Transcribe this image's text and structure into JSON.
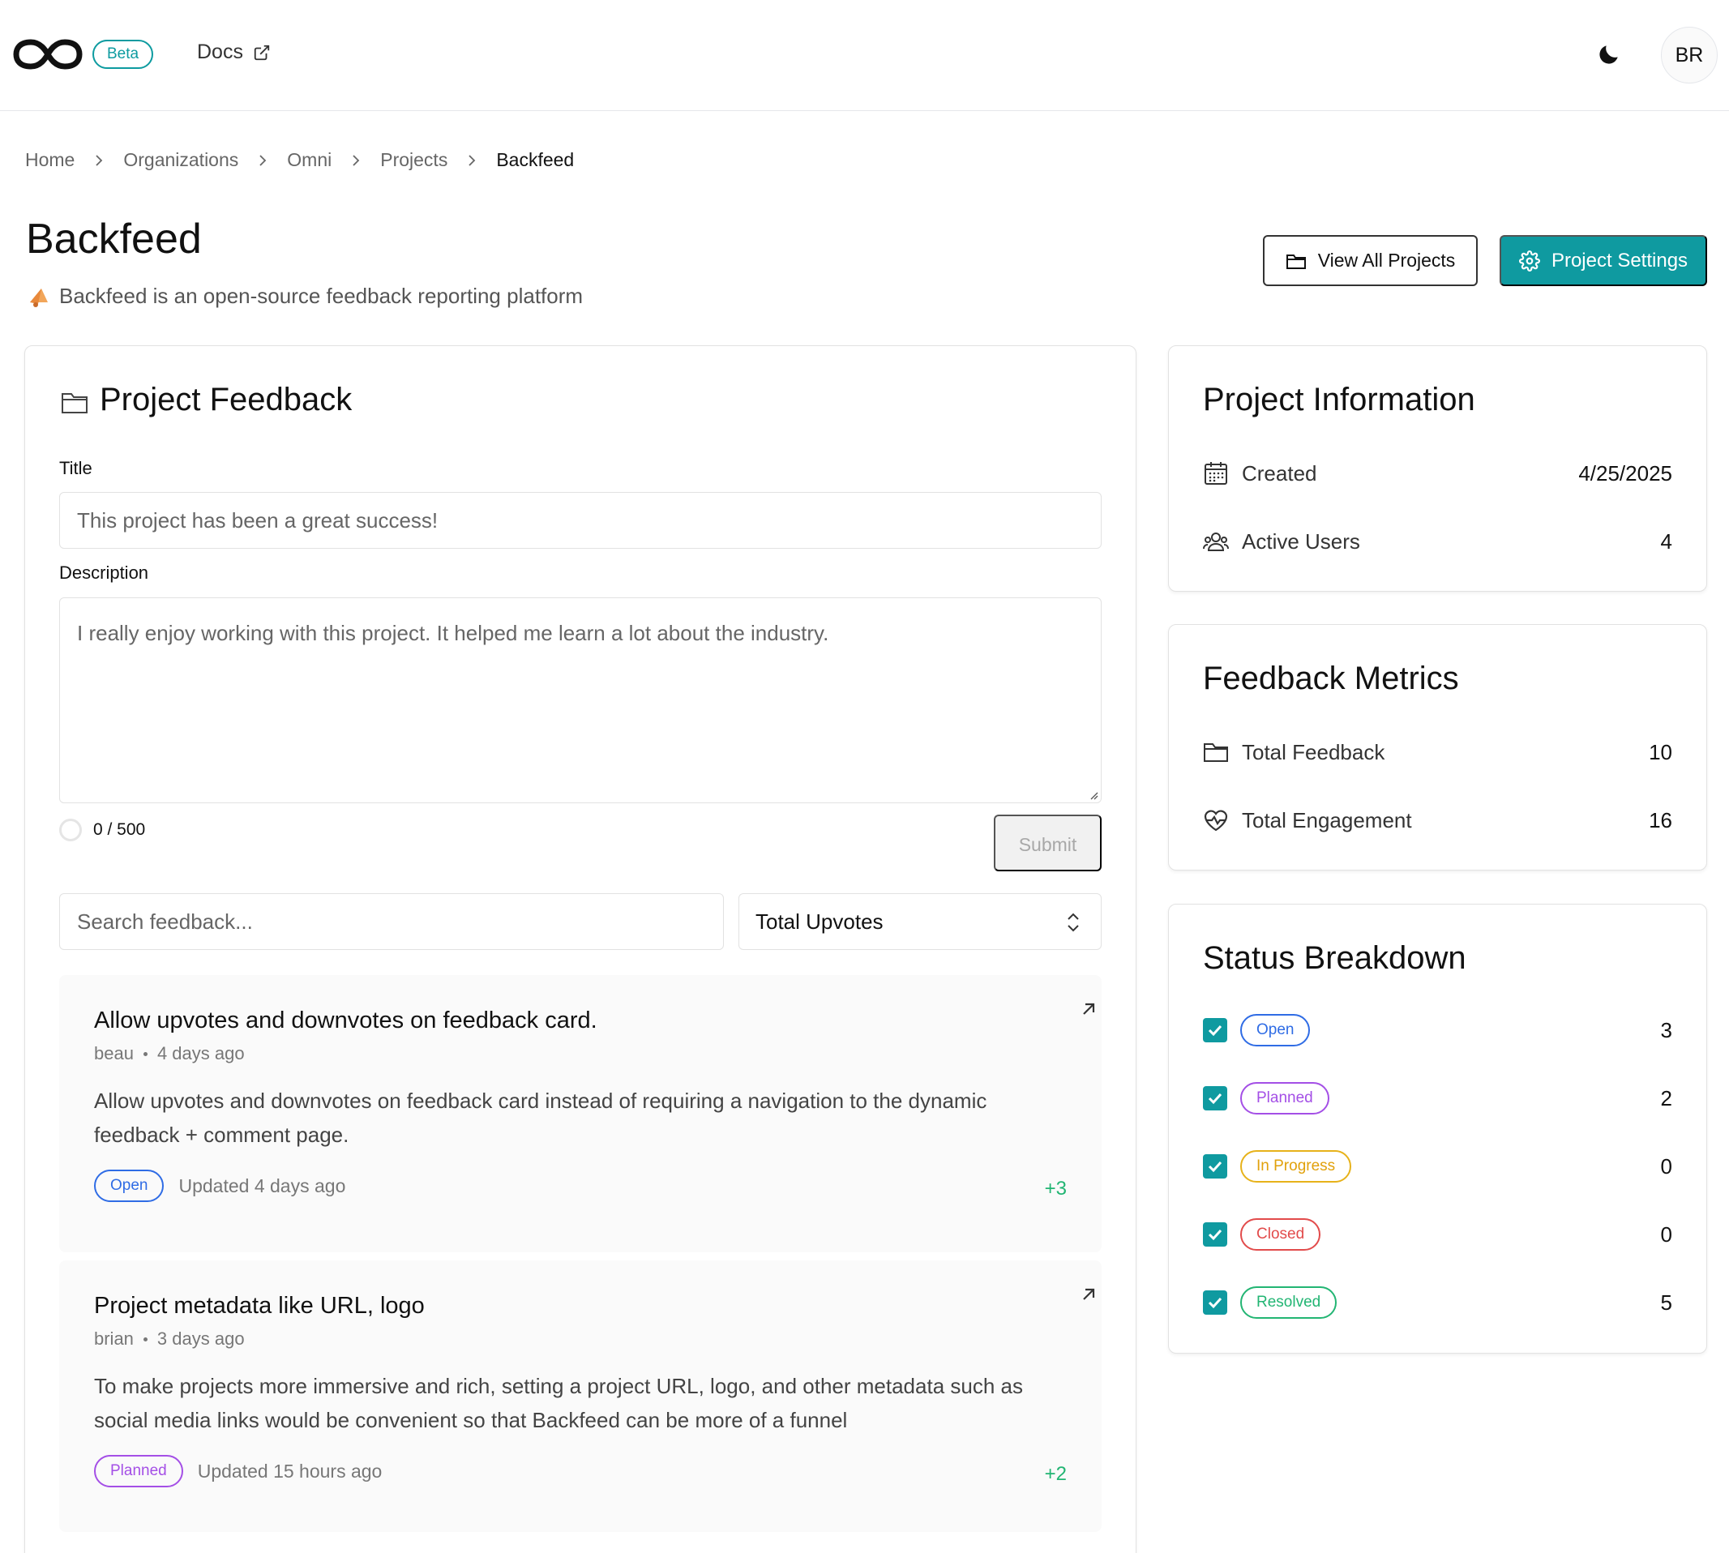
{
  "header": {
    "beta_label": "Beta",
    "docs_label": "Docs",
    "avatar_initials": "BR",
    "accent_color": "#0f9aa0"
  },
  "breadcrumb": [
    "Home",
    "Organizations",
    "Omni",
    "Projects",
    "Backfeed"
  ],
  "page": {
    "title": "Backfeed",
    "subtitle": "Backfeed is an open-source feedback reporting platform",
    "view_all_label": "View All Projects",
    "settings_label": "Project Settings"
  },
  "feedback_form": {
    "heading": "Project Feedback",
    "title_label": "Title",
    "title_placeholder": "This project has been a great success!",
    "description_label": "Description",
    "description_placeholder": "I really enjoy working with this project. It helped me learn a lot about the industry.",
    "char_counter": "0 / 500",
    "submit_label": "Submit",
    "search_placeholder": "Search feedback...",
    "sort_value": "Total Upvotes"
  },
  "feedback_items": [
    {
      "title": "Allow upvotes and downvotes on feedback card.",
      "author": "beau",
      "age": "4 days ago",
      "body": "Allow upvotes and downvotes on feedback card instead of requiring a navigation to the dynamic feedback + comment page.",
      "status": "Open",
      "updated": "Updated 4 days ago",
      "votes": "+3"
    },
    {
      "title": "Project metadata like URL, logo",
      "author": "brian",
      "age": "3 days ago",
      "body": "To make projects more immersive and rich, setting a project URL, logo, and other metadata such as social media links would be convenient so that Backfeed can be more of a funnel",
      "status": "Planned",
      "updated": "Updated 15 hours ago",
      "votes": "+2"
    }
  ],
  "project_info": {
    "heading": "Project Information",
    "created_label": "Created",
    "created_value": "4/25/2025",
    "users_label": "Active Users",
    "users_value": "4"
  },
  "metrics": {
    "heading": "Feedback Metrics",
    "total_feedback_label": "Total Feedback",
    "total_feedback_value": "10",
    "engagement_label": "Total Engagement",
    "engagement_value": "16"
  },
  "status_breakdown": {
    "heading": "Status Breakdown",
    "items": [
      {
        "label": "Open",
        "count": "3",
        "color": "#2f6ce5"
      },
      {
        "label": "Planned",
        "count": "2",
        "color": "#a44fe6"
      },
      {
        "label": "In Progress",
        "count": "0",
        "color": "#e1a10b"
      },
      {
        "label": "Closed",
        "count": "0",
        "color": "#e24b4b"
      },
      {
        "label": "Resolved",
        "count": "5",
        "color": "#22b573"
      }
    ]
  }
}
